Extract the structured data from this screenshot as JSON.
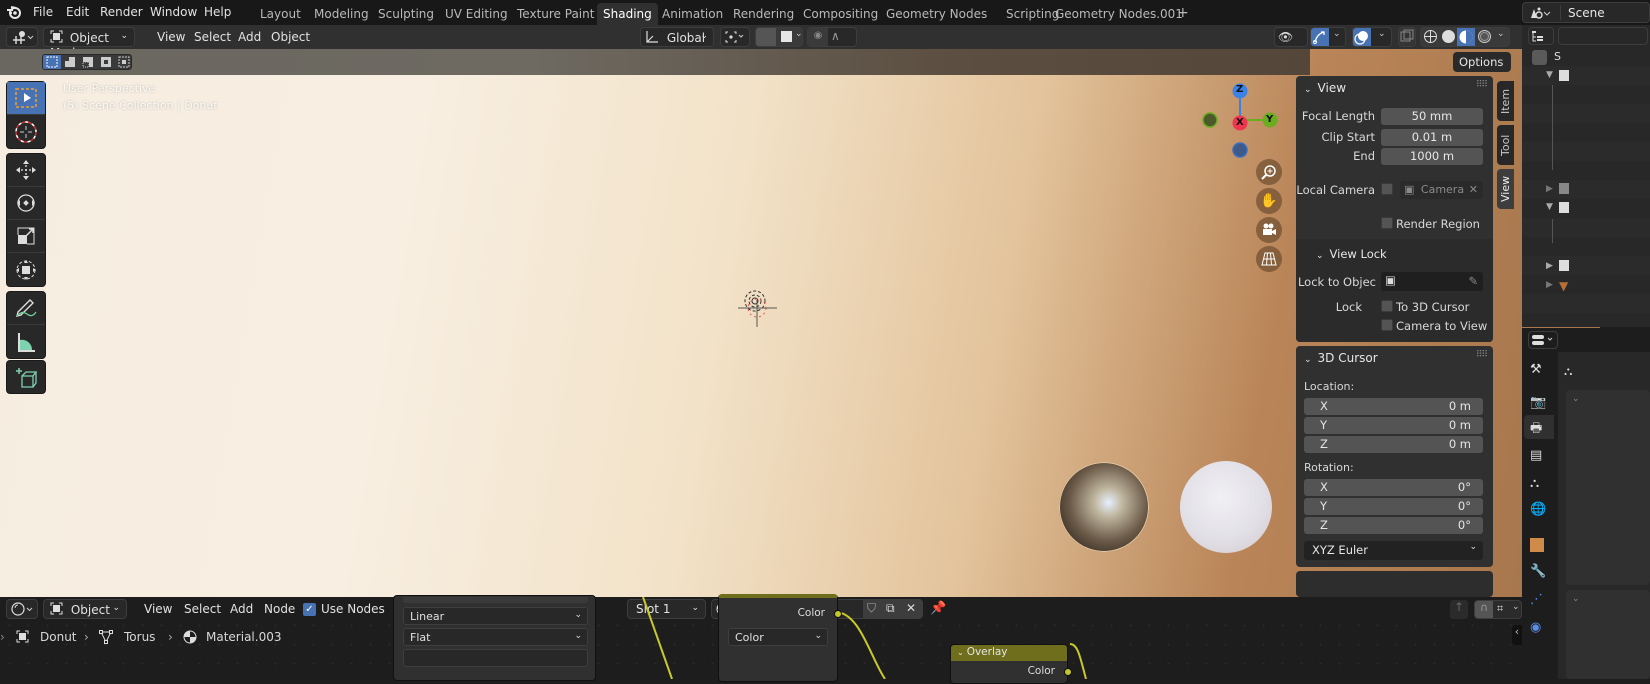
{
  "app": {
    "name": "Blender"
  },
  "menus": [
    "File",
    "Edit",
    "Render",
    "Window",
    "Help"
  ],
  "workspaces": [
    {
      "label": "Layout",
      "active": false
    },
    {
      "label": "Modeling",
      "active": false
    },
    {
      "label": "Sculpting",
      "active": false
    },
    {
      "label": "UV Editing",
      "active": false
    },
    {
      "label": "Texture Paint",
      "active": false
    },
    {
      "label": "Shading",
      "active": true
    },
    {
      "label": "Animation",
      "active": false
    },
    {
      "label": "Rendering",
      "active": false
    },
    {
      "label": "Compositing",
      "active": false
    },
    {
      "label": "Geometry Nodes",
      "active": false
    },
    {
      "label": "Scripting",
      "active": false
    },
    {
      "label": "Geometry Nodes.001",
      "active": false
    }
  ],
  "add_workspace": "+",
  "scene": {
    "name": "Scene"
  },
  "viewport_header": {
    "mode": "Object Mode",
    "menus": [
      "View",
      "Select",
      "Add",
      "Object"
    ],
    "transform_orientation": "Global",
    "options_label": "Options"
  },
  "viewport": {
    "perspective_label": "User Perspective",
    "collection_label": "(5) Scene Collection | Donut",
    "gizmo_axes": {
      "z": "Z",
      "x": "X",
      "y": "Y"
    },
    "accent_color": "#4772b3"
  },
  "npanel": {
    "tabs": [
      "Item",
      "Tool",
      "View"
    ],
    "active_tab": "View",
    "view": {
      "title": "View",
      "focal_length_label": "Focal Length",
      "focal_length": "50 mm",
      "clip_start_label": "Clip Start",
      "clip_start": "0.01 m",
      "end_label": "End",
      "end": "1000 m",
      "local_camera_label": "Local Camera",
      "local_camera_value": "Camera",
      "render_region_label": "Render Region"
    },
    "view_lock": {
      "title": "View Lock",
      "lock_to_object_label": "Lock to Objec",
      "lock_label": "Lock",
      "to_3d_cursor": "To 3D Cursor",
      "camera_to_view": "Camera to View"
    },
    "cursor": {
      "title": "3D Cursor",
      "location_label": "Location:",
      "location": [
        {
          "axis": "X",
          "value": "0 m"
        },
        {
          "axis": "Y",
          "value": "0 m"
        },
        {
          "axis": "Z",
          "value": "0 m"
        }
      ],
      "rotation_label": "Rotation:",
      "rotation": [
        {
          "axis": "X",
          "value": "0°"
        },
        {
          "axis": "Y",
          "value": "0°"
        },
        {
          "axis": "Z",
          "value": "0°"
        }
      ],
      "rotation_mode": "XYZ Euler"
    }
  },
  "outliner": {
    "root_label": "S"
  },
  "node_editor": {
    "object_mode": "Object",
    "menus": [
      "View",
      "Select",
      "Add",
      "Node"
    ],
    "use_nodes_label": "Use Nodes",
    "use_nodes": true,
    "slot": "Slot 1",
    "material": "Material.003",
    "breadcrumb": [
      "Donut",
      "Torus",
      "Material.003"
    ],
    "nodes": {
      "left_dropdowns": [
        "Linear",
        "Flat"
      ],
      "center_output": "Color",
      "center_dropdown": "Color",
      "overlay_title": "Overlay",
      "overlay_output": "Color"
    }
  }
}
